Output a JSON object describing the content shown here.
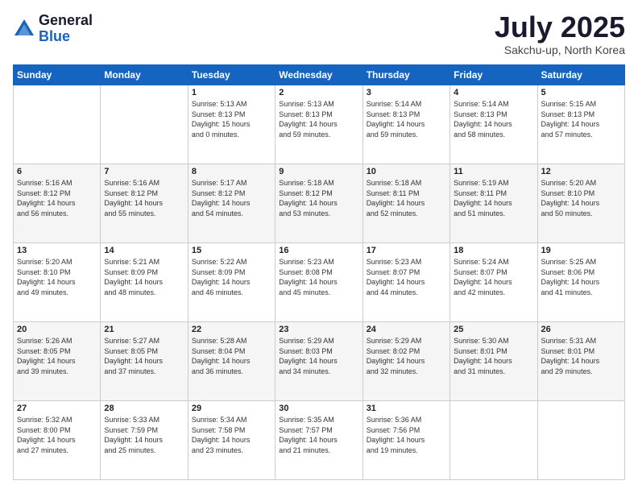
{
  "logo": {
    "general": "General",
    "blue": "Blue"
  },
  "header": {
    "month": "July 2025",
    "location": "Sakchu-up, North Korea"
  },
  "weekdays": [
    "Sunday",
    "Monday",
    "Tuesday",
    "Wednesday",
    "Thursday",
    "Friday",
    "Saturday"
  ],
  "weeks": [
    [
      {
        "day": "",
        "info": ""
      },
      {
        "day": "",
        "info": ""
      },
      {
        "day": "1",
        "info": "Sunrise: 5:13 AM\nSunset: 8:13 PM\nDaylight: 15 hours\nand 0 minutes."
      },
      {
        "day": "2",
        "info": "Sunrise: 5:13 AM\nSunset: 8:13 PM\nDaylight: 14 hours\nand 59 minutes."
      },
      {
        "day": "3",
        "info": "Sunrise: 5:14 AM\nSunset: 8:13 PM\nDaylight: 14 hours\nand 59 minutes."
      },
      {
        "day": "4",
        "info": "Sunrise: 5:14 AM\nSunset: 8:13 PM\nDaylight: 14 hours\nand 58 minutes."
      },
      {
        "day": "5",
        "info": "Sunrise: 5:15 AM\nSunset: 8:13 PM\nDaylight: 14 hours\nand 57 minutes."
      }
    ],
    [
      {
        "day": "6",
        "info": "Sunrise: 5:16 AM\nSunset: 8:12 PM\nDaylight: 14 hours\nand 56 minutes."
      },
      {
        "day": "7",
        "info": "Sunrise: 5:16 AM\nSunset: 8:12 PM\nDaylight: 14 hours\nand 55 minutes."
      },
      {
        "day": "8",
        "info": "Sunrise: 5:17 AM\nSunset: 8:12 PM\nDaylight: 14 hours\nand 54 minutes."
      },
      {
        "day": "9",
        "info": "Sunrise: 5:18 AM\nSunset: 8:12 PM\nDaylight: 14 hours\nand 53 minutes."
      },
      {
        "day": "10",
        "info": "Sunrise: 5:18 AM\nSunset: 8:11 PM\nDaylight: 14 hours\nand 52 minutes."
      },
      {
        "day": "11",
        "info": "Sunrise: 5:19 AM\nSunset: 8:11 PM\nDaylight: 14 hours\nand 51 minutes."
      },
      {
        "day": "12",
        "info": "Sunrise: 5:20 AM\nSunset: 8:10 PM\nDaylight: 14 hours\nand 50 minutes."
      }
    ],
    [
      {
        "day": "13",
        "info": "Sunrise: 5:20 AM\nSunset: 8:10 PM\nDaylight: 14 hours\nand 49 minutes."
      },
      {
        "day": "14",
        "info": "Sunrise: 5:21 AM\nSunset: 8:09 PM\nDaylight: 14 hours\nand 48 minutes."
      },
      {
        "day": "15",
        "info": "Sunrise: 5:22 AM\nSunset: 8:09 PM\nDaylight: 14 hours\nand 46 minutes."
      },
      {
        "day": "16",
        "info": "Sunrise: 5:23 AM\nSunset: 8:08 PM\nDaylight: 14 hours\nand 45 minutes."
      },
      {
        "day": "17",
        "info": "Sunrise: 5:23 AM\nSunset: 8:07 PM\nDaylight: 14 hours\nand 44 minutes."
      },
      {
        "day": "18",
        "info": "Sunrise: 5:24 AM\nSunset: 8:07 PM\nDaylight: 14 hours\nand 42 minutes."
      },
      {
        "day": "19",
        "info": "Sunrise: 5:25 AM\nSunset: 8:06 PM\nDaylight: 14 hours\nand 41 minutes."
      }
    ],
    [
      {
        "day": "20",
        "info": "Sunrise: 5:26 AM\nSunset: 8:05 PM\nDaylight: 14 hours\nand 39 minutes."
      },
      {
        "day": "21",
        "info": "Sunrise: 5:27 AM\nSunset: 8:05 PM\nDaylight: 14 hours\nand 37 minutes."
      },
      {
        "day": "22",
        "info": "Sunrise: 5:28 AM\nSunset: 8:04 PM\nDaylight: 14 hours\nand 36 minutes."
      },
      {
        "day": "23",
        "info": "Sunrise: 5:29 AM\nSunset: 8:03 PM\nDaylight: 14 hours\nand 34 minutes."
      },
      {
        "day": "24",
        "info": "Sunrise: 5:29 AM\nSunset: 8:02 PM\nDaylight: 14 hours\nand 32 minutes."
      },
      {
        "day": "25",
        "info": "Sunrise: 5:30 AM\nSunset: 8:01 PM\nDaylight: 14 hours\nand 31 minutes."
      },
      {
        "day": "26",
        "info": "Sunrise: 5:31 AM\nSunset: 8:01 PM\nDaylight: 14 hours\nand 29 minutes."
      }
    ],
    [
      {
        "day": "27",
        "info": "Sunrise: 5:32 AM\nSunset: 8:00 PM\nDaylight: 14 hours\nand 27 minutes."
      },
      {
        "day": "28",
        "info": "Sunrise: 5:33 AM\nSunset: 7:59 PM\nDaylight: 14 hours\nand 25 minutes."
      },
      {
        "day": "29",
        "info": "Sunrise: 5:34 AM\nSunset: 7:58 PM\nDaylight: 14 hours\nand 23 minutes."
      },
      {
        "day": "30",
        "info": "Sunrise: 5:35 AM\nSunset: 7:57 PM\nDaylight: 14 hours\nand 21 minutes."
      },
      {
        "day": "31",
        "info": "Sunrise: 5:36 AM\nSunset: 7:56 PM\nDaylight: 14 hours\nand 19 minutes."
      },
      {
        "day": "",
        "info": ""
      },
      {
        "day": "",
        "info": ""
      }
    ]
  ]
}
